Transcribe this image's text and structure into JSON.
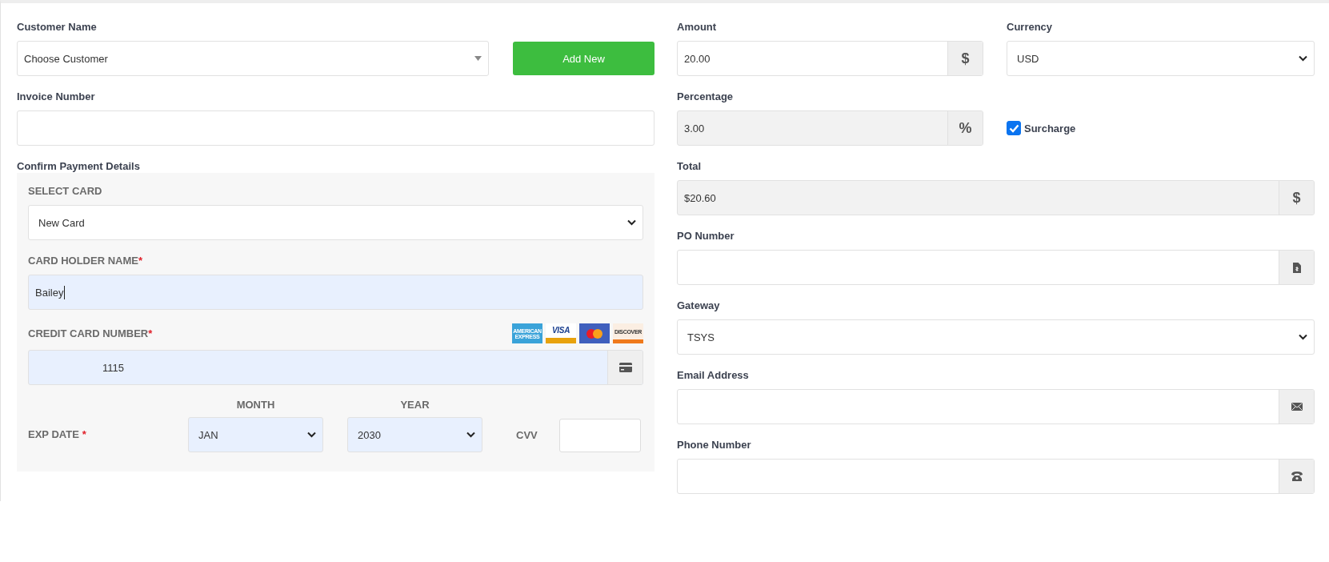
{
  "customer": {
    "label": "Customer Name",
    "value": "Choose Customer"
  },
  "add_button": {
    "label": "Add New"
  },
  "invoice": {
    "label": "Invoice Number"
  },
  "payment": {
    "title": "Confirm Payment Details",
    "select_card": {
      "label": "SELECT CARD",
      "value": "New Card"
    },
    "holder": {
      "label": "CARD HOLDER NAME",
      "mark": "*",
      "value": "Bailey",
      "autofilled": true,
      "focused": true
    },
    "card_number": {
      "label": "CREDIT CARD NUMBER",
      "mark": "*",
      "value": "1115",
      "autofilled": true
    },
    "brands": [
      {
        "kind": "amex",
        "label": "AMERICAN EXPRESS"
      },
      {
        "kind": "visa",
        "label": "VISA"
      },
      {
        "kind": "mastercard"
      },
      {
        "kind": "discover",
        "label": "DISCOVER"
      }
    ],
    "exp": {
      "label": "EXP DATE",
      "mark": "*",
      "month": {
        "label": "MONTH",
        "value": "JAN",
        "autofilled": true
      },
      "year": {
        "label": "YEAR",
        "value": "2030",
        "autofilled": true
      }
    },
    "cvv": {
      "label": "CVV"
    }
  },
  "amount": {
    "label": "Amount",
    "value": "20.00",
    "addon": "$",
    "disabled": false
  },
  "currency": {
    "label": "Currency",
    "value": "USD"
  },
  "percentage": {
    "label": "Percentage",
    "value": "3.00",
    "addon": "%",
    "disabled": true
  },
  "surcharge": {
    "label": "Surcharge",
    "checked": true
  },
  "total": {
    "label": "Total",
    "value": "$20.60",
    "addon": "$",
    "disabled": true
  },
  "po_number": {
    "label": "PO Number"
  },
  "gateway": {
    "label": "Gateway",
    "value": "TSYS"
  },
  "email": {
    "label": "Email Address"
  },
  "phone": {
    "label": "Phone Number"
  }
}
